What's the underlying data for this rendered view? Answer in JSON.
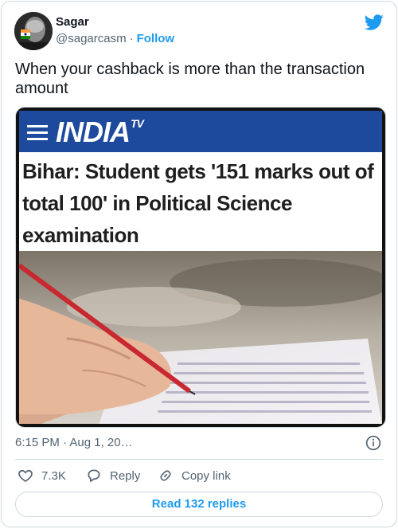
{
  "author": {
    "name": "Sagar",
    "handle": "@sagarcasm",
    "separator": "·",
    "follow_label": "Follow"
  },
  "tweet": {
    "text": "When your cashback is more than the transaction amount"
  },
  "media": {
    "brand_main": "INDIA",
    "brand_sup": "TV",
    "headline": "Bihar: Student gets '151 marks out of total 100' in Political Science examination",
    "brand_color": "#1e4a9e"
  },
  "meta": {
    "timestamp": "6:15 PM · Aug 1, 20…"
  },
  "actions": {
    "like_count": "7.3K",
    "reply_label": "Reply",
    "copy_label": "Copy link"
  },
  "replies_button": "Read 132 replies",
  "icons": [
    "twitter-bird-icon",
    "info-icon",
    "heart-icon",
    "reply-bubble-icon",
    "link-icon",
    "hamburger-icon"
  ],
  "colors": {
    "accent": "#1d9bf0",
    "muted": "#536471",
    "border": "#cfd9de"
  }
}
